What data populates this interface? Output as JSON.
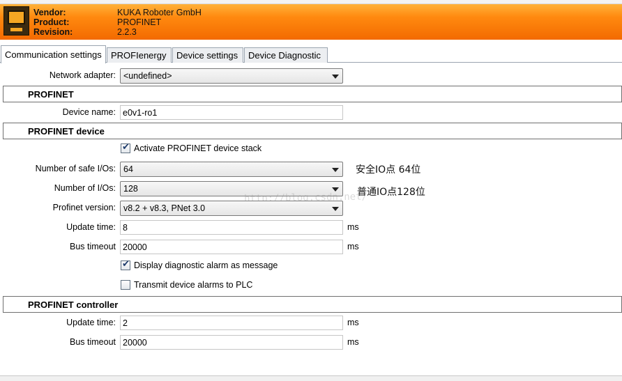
{
  "header": {
    "vendor_label": "Vendor:",
    "vendor_value": "KUKA Roboter GmbH",
    "product_label": "Product:",
    "product_value": "PROFINET",
    "revision_label": "Revision:",
    "revision_value": "2.2.3",
    "colors": {
      "banner_top": "#ffb23a",
      "banner_bottom": "#f36a00"
    }
  },
  "tabs": [
    {
      "label": "Communication settings",
      "active": true
    },
    {
      "label": "PROFIenergy",
      "active": false
    },
    {
      "label": "Device settings",
      "active": false
    },
    {
      "label": "Device Diagnostic",
      "active": false
    }
  ],
  "network_adapter": {
    "label": "Network adapter:",
    "value": "<undefined>"
  },
  "profinet": {
    "section_title": "PROFINET",
    "device_name_label": "Device name:",
    "device_name_value": "e0v1-ro1"
  },
  "profinet_device": {
    "section_title": "PROFINET device",
    "activate_stack": {
      "label": "Activate PROFINET device stack",
      "checked": true
    },
    "safe_ios": {
      "label": "Number of safe I/Os:",
      "value": "64",
      "annotation": "安全IO点 64位"
    },
    "ios": {
      "label": "Number of I/Os:",
      "value": "128",
      "annotation": "普通IO点128位"
    },
    "version": {
      "label": "Profinet version:",
      "value": "v8.2 + v8.3, PNet 3.0"
    },
    "update_time": {
      "label": "Update time:",
      "value": "8",
      "unit": "ms"
    },
    "bus_timeout": {
      "label": "Bus timeout",
      "value": "20000",
      "unit": "ms"
    },
    "diag_alarm": {
      "label": "Display diagnostic alarm as message",
      "checked": true
    },
    "transmit_alarms": {
      "label": "Transmit device alarms to PLC",
      "checked": false
    }
  },
  "profinet_controller": {
    "section_title": "PROFINET controller",
    "update_time": {
      "label": "Update time:",
      "value": "2",
      "unit": "ms"
    },
    "bus_timeout": {
      "label": "Bus timeout",
      "value": "20000",
      "unit": "ms"
    }
  },
  "watermark": "http://blog.csdn.net/",
  "icons": {
    "checked": "check-mark-icon",
    "dropdown": "chevron-down-icon",
    "logo": "kuka-controller-icon"
  }
}
